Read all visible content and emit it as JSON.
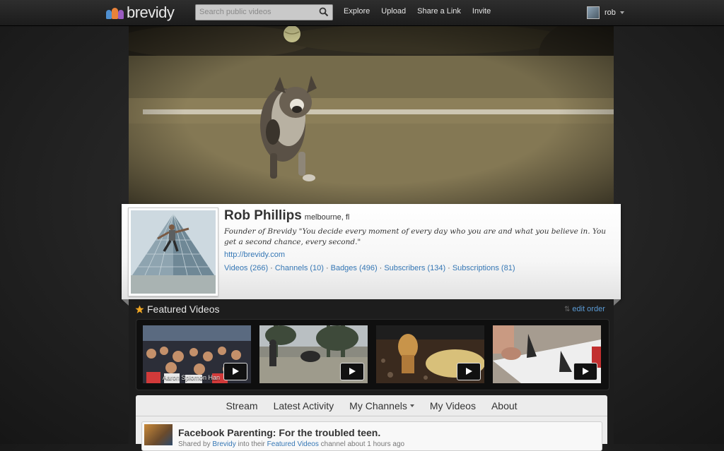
{
  "app": {
    "logo_text": "brevidy",
    "colors": {
      "logo_blue": "#4f8fd0",
      "logo_orange": "#e8823a",
      "logo_purple": "#9a5cc0",
      "link": "#3577b5"
    }
  },
  "header": {
    "search_placeholder": "Search public videos",
    "search_icon": "search-icon",
    "nav": [
      "Explore",
      "Upload",
      "Share a Link",
      "Invite"
    ],
    "user_name": "rob"
  },
  "profile": {
    "name": "Rob Phillips",
    "location": "melbourne, fl",
    "bio": "Founder of Brevidy \"You decide every moment of every day who you are and what you believe in. You get a second chance, every second.\"",
    "url": "http://brevidy.com",
    "stats": [
      "Videos (266)",
      "Channels (10)",
      "Badges (496)",
      "Subscribers (134)",
      "Subscriptions (81)"
    ],
    "separator": "·"
  },
  "featured": {
    "title": "Featured Videos",
    "edit_label": "edit order",
    "videos": [
      {
        "caption": "Aaron Splomon Han"
      },
      {
        "caption": ""
      },
      {
        "caption": ""
      },
      {
        "caption": ""
      }
    ]
  },
  "tabs": [
    "Stream",
    "Latest Activity",
    "My Channels",
    "My Videos",
    "About"
  ],
  "stream": {
    "item_title": "Facebook Parenting: For the troubled teen.",
    "meta_prefix": "Shared by",
    "meta_user": "Brevidy",
    "meta_middle": "into their",
    "meta_channel": "Featured Videos",
    "meta_suffix": "channel about 1 hours ago"
  }
}
